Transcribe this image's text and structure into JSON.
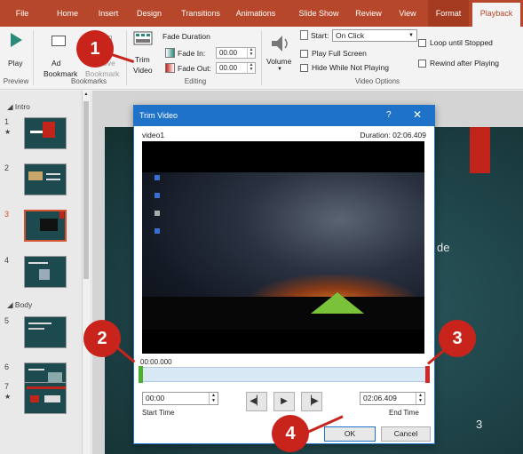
{
  "ribbon": {
    "tabs": [
      "File",
      "Home",
      "Insert",
      "Design",
      "Transitions",
      "Animations",
      "Slide Show",
      "Review",
      "View",
      "Format",
      "Playback"
    ],
    "active_tab": "Playback",
    "play_label": "Play",
    "add_bookmark_label_1": "Ad",
    "add_bookmark_label_2": "Bookmark",
    "remove_bookmark_label_1": "ove",
    "remove_bookmark_label_2": "Bookmark",
    "trim_label_1": "Trim",
    "trim_label_2": "Video",
    "fade_duration_label": "Fade Duration",
    "fade_in_label": "Fade In:",
    "fade_in_value": "00.00",
    "fade_out_label": "Fade Out:",
    "fade_out_value": "00.00",
    "volume_label": "Volume",
    "start_label": "Start:",
    "start_value": "On Click",
    "play_full_screen_label": "Play Full Screen",
    "hide_label": "Hide While Not Playing",
    "loop_label": "Loop until Stopped",
    "rewind_label": "Rewind after Playing",
    "groups": {
      "preview": "Preview",
      "bookmarks": "Bookmarks",
      "editing": "Editing",
      "video_options": "Video Options"
    }
  },
  "slide_pane": {
    "sections": [
      "Intro",
      "Body"
    ],
    "slide_numbers": [
      "1",
      "2",
      "3",
      "4",
      "5",
      "6",
      "7"
    ],
    "star": "★"
  },
  "slide": {
    "partial_text": "de",
    "page_number": "3"
  },
  "dialog": {
    "title": "Trim Video",
    "help": "?",
    "close": "✕",
    "video_name": "video1",
    "duration": "Duration: 02:06.409",
    "timecode": "00:00.000",
    "start_time_value": "00:00",
    "start_time_label": "Start Time",
    "end_time_value": "02:06.409",
    "end_time_label": "End Time",
    "ok_label": "OK",
    "cancel_label": "Cancel"
  },
  "callouts": [
    "1",
    "2",
    "3",
    "4"
  ],
  "colors": {
    "accent": "#b7472a",
    "dialog_blue": "#1e72c8",
    "callout_red": "#c8241c",
    "start_handle": "#4caf2e",
    "end_handle": "#d02828"
  }
}
